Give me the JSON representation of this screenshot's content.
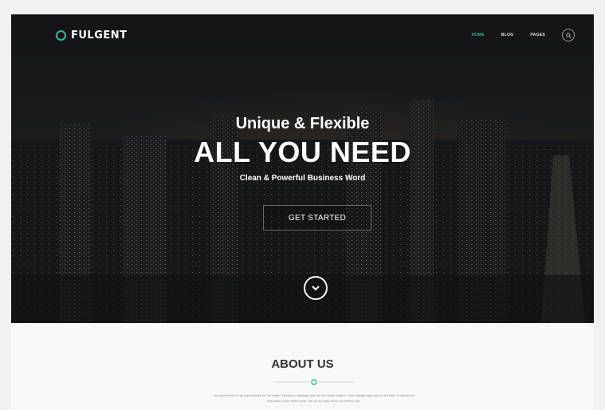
{
  "brand": {
    "name": "FULGENT",
    "accent": "#38b59a"
  },
  "nav": {
    "items": [
      {
        "label": "HOME",
        "active": true
      },
      {
        "label": "BLOG",
        "active": false
      },
      {
        "label": "PAGES",
        "active": false
      }
    ],
    "search_icon": "search-icon"
  },
  "hero": {
    "subtitle": "Unique & Flexible",
    "title": "ALL YOU NEED",
    "tagline": "Clean & Powerful Business Word",
    "cta_label": "GET STARTED",
    "scroll_icon": "chevron-down-icon"
  },
  "about": {
    "title": "ABOUT US",
    "text_line1": "Our goal is first of all a good base for the brand. Develop a strategic plan for the entire project. Good design approach in the field. Professional",
    "text_line2": "execution of the entire work. We do not stop when our client's use."
  }
}
